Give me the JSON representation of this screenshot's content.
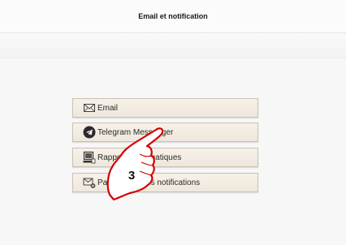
{
  "header": {
    "title": "Email et notification"
  },
  "menu": {
    "items": [
      {
        "label": "Email",
        "icon": "envelope-icon"
      },
      {
        "label": "Telegram Messenger",
        "icon": "telegram-icon"
      },
      {
        "label": "Rapports automatiques",
        "icon": "report-computer-icon"
      },
      {
        "label": "Paramètres des notifications",
        "icon": "envelope-gear-icon"
      }
    ]
  },
  "annotation": {
    "step_number": "3"
  }
}
